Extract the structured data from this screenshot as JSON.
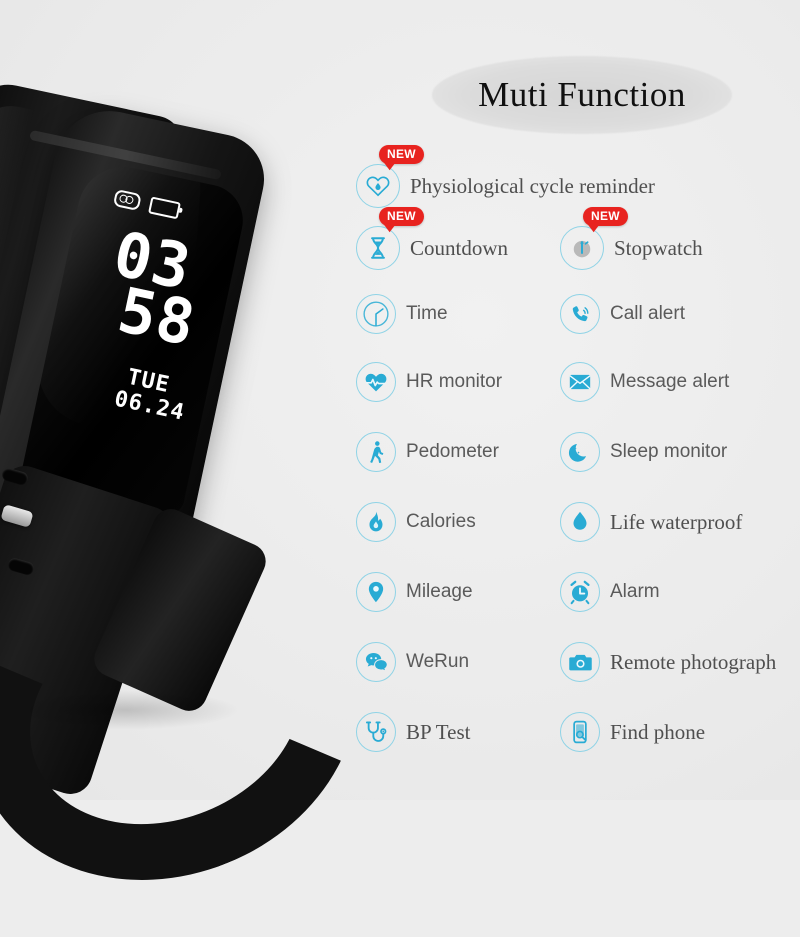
{
  "title": {
    "text": "Muti Function"
  },
  "colors": {
    "background": "#ededed",
    "icon_cyan": "#29abd4",
    "icon_ring": "#8fd3e6",
    "badge_red": "#e8231f",
    "label_gray": "#5a5a5a",
    "watch_black": "#111111"
  },
  "badge": {
    "label": "NEW"
  },
  "watch": {
    "screen": {
      "hours": "03",
      "minutes": "58",
      "weekday": "TUE",
      "date": "06.24",
      "status_icons": [
        "bluetooth-icon",
        "battery-icon"
      ]
    }
  },
  "features": [
    {
      "label": "Physiological cycle reminder",
      "icon": "heart-droplet-icon",
      "badge": "NEW",
      "font": "serif",
      "col": 0,
      "row": 0,
      "wide": true
    },
    {
      "label": "Countdown",
      "icon": "hourglass-icon",
      "badge": "NEW",
      "font": "serif",
      "col": 0,
      "row": 1
    },
    {
      "label": "Stopwatch",
      "icon": "stopwatch-icon",
      "badge": "NEW",
      "font": "serif",
      "col": 1,
      "row": 1
    },
    {
      "label": "Time",
      "icon": "clock-icon",
      "badge": "",
      "font": "sans",
      "col": 0,
      "row": 2
    },
    {
      "label": "Call alert",
      "icon": "phone-ring-icon",
      "badge": "",
      "font": "sans",
      "col": 1,
      "row": 2
    },
    {
      "label": "HR monitor",
      "icon": "heart-pulse-icon",
      "badge": "",
      "font": "sans",
      "col": 0,
      "row": 3
    },
    {
      "label": "Message alert",
      "icon": "envelope-icon",
      "badge": "",
      "font": "sans",
      "col": 1,
      "row": 3
    },
    {
      "label": "Pedometer",
      "icon": "walking-person-icon",
      "badge": "",
      "font": "sans",
      "col": 0,
      "row": 4
    },
    {
      "label": "Sleep monitor",
      "icon": "moon-stars-icon",
      "badge": "",
      "font": "sans",
      "col": 1,
      "row": 4
    },
    {
      "label": "Calories",
      "icon": "flame-icon",
      "badge": "",
      "font": "sans",
      "col": 0,
      "row": 5
    },
    {
      "label": "Life waterproof",
      "icon": "water-drop-icon",
      "badge": "",
      "font": "serif",
      "col": 1,
      "row": 5
    },
    {
      "label": "Mileage",
      "icon": "map-pin-icon",
      "badge": "",
      "font": "sans",
      "col": 0,
      "row": 6
    },
    {
      "label": "Alarm",
      "icon": "alarm-clock-icon",
      "badge": "",
      "font": "sans",
      "col": 1,
      "row": 6
    },
    {
      "label": "WeRun",
      "icon": "wechat-bubbles-icon",
      "badge": "",
      "font": "sans",
      "col": 0,
      "row": 7
    },
    {
      "label": "Remote photograph",
      "icon": "camera-icon",
      "badge": "",
      "font": "serif",
      "col": 1,
      "row": 7
    },
    {
      "label": "BP Test",
      "icon": "stethoscope-icon",
      "badge": "",
      "font": "serif",
      "col": 0,
      "row": 8
    },
    {
      "label": "Find phone",
      "icon": "phone-search-icon",
      "badge": "",
      "font": "serif",
      "col": 1,
      "row": 8
    }
  ]
}
